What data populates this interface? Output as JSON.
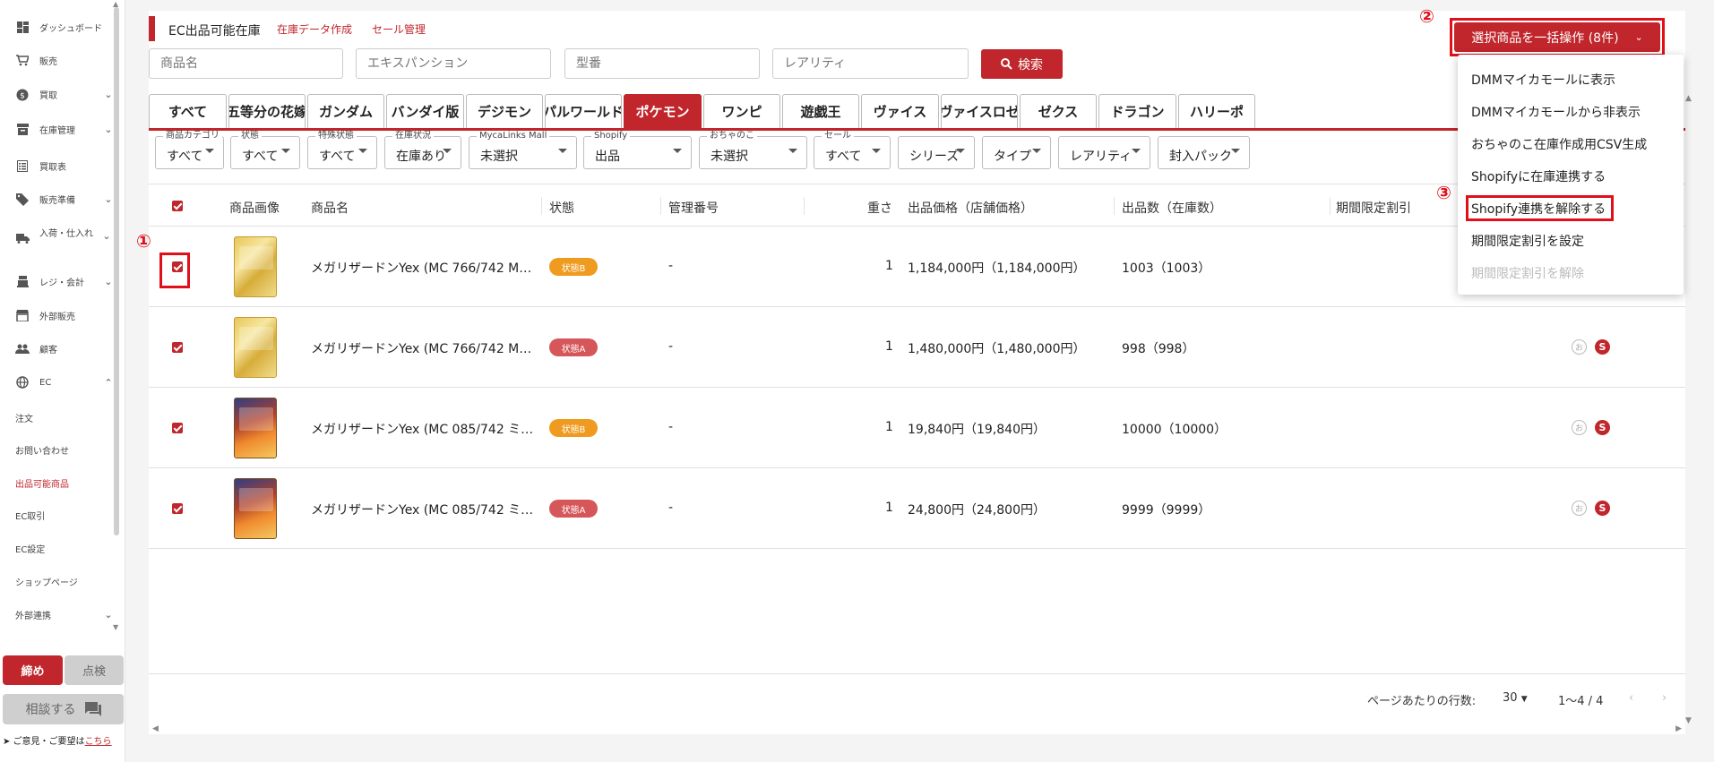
{
  "sidebar": {
    "items": [
      {
        "label": "ダッシュボード",
        "icon": "dashboard-icon",
        "chevron": ""
      },
      {
        "label": "販売",
        "icon": "cart-icon",
        "chevron": ""
      },
      {
        "label": "買取",
        "icon": "dollar-icon",
        "chevron": "⌄"
      },
      {
        "label": "在庫管理",
        "icon": "archive-icon",
        "chevron": "⌄"
      },
      {
        "label": "買取表",
        "icon": "list-icon",
        "chevron": ""
      },
      {
        "label": "販売準備",
        "icon": "tag-icon",
        "chevron": "⌄"
      },
      {
        "label": "入荷・仕入れ",
        "icon": "truck-icon",
        "chevron": "⌄"
      },
      {
        "label": "レジ・会計",
        "icon": "register-icon",
        "chevron": "⌄"
      },
      {
        "label": "外部販売",
        "icon": "store-icon",
        "chevron": ""
      },
      {
        "label": "顧客",
        "icon": "people-icon",
        "chevron": ""
      },
      {
        "label": "EC",
        "icon": "globe-icon",
        "chevron": "⌃"
      }
    ],
    "ec_sub": [
      "注文",
      "お問い合わせ",
      "出品可能商品",
      "EC取引",
      "EC設定",
      "ショップページ"
    ],
    "external": {
      "label": "外部連携",
      "chevron": "⌄"
    },
    "close_label": "締め",
    "inspect_label": "点検",
    "consult_label": "相談する",
    "feedback_prefix": "➤ ご意見・ご要望は",
    "feedback_link": "こちら"
  },
  "header": {
    "title": "EC出品可能在庫",
    "link1": "在庫データ作成",
    "link2": "セール管理"
  },
  "search": {
    "name_placeholder": "商品名",
    "expansion_placeholder": "エキスパンション",
    "model_placeholder": "型番",
    "rarity_placeholder": "レアリティ",
    "button_label": "検索"
  },
  "bulk": {
    "button_label": "選択商品を一括操作 (8件)",
    "menu": [
      "DMMマイカモールに表示",
      "DMMマイカモールから非表示",
      "おちゃのこ在庫作成用CSV生成",
      "Shopifyに在庫連携する",
      "Shopify連携を解除する",
      "期間限定割引を設定",
      "期間限定割引を解除"
    ]
  },
  "annotations": {
    "n1": "①",
    "n2": "②",
    "n3": "③"
  },
  "tabs": [
    "すべて",
    "五等分の花嫁",
    "ガンダム",
    "バンダイ版",
    "デジモン",
    "パルワールド",
    "ポケモン",
    "ワンピ",
    "遊戯王",
    "ヴァイス",
    "ヴァイスロゼ",
    "ゼクス",
    "ドラゴン",
    "ハリーポ"
  ],
  "active_tab": "ポケモン",
  "filters": [
    {
      "label": "商品カテゴリ",
      "value": "すべて"
    },
    {
      "label": "状態",
      "value": "すべて"
    },
    {
      "label": "特殊状態",
      "value": "すべて"
    },
    {
      "label": "在庫状況",
      "value": "在庫あり"
    },
    {
      "label": "MycaLinks Mall",
      "value": "未選択"
    },
    {
      "label": "Shopify",
      "value": "出品"
    },
    {
      "label": "おちゃのこ",
      "value": "未選択"
    },
    {
      "label": "セール",
      "value": "すべて"
    },
    {
      "label": "",
      "value": "シリーズ"
    },
    {
      "label": "",
      "value": "タイプ"
    },
    {
      "label": "",
      "value": "レアリティ"
    },
    {
      "label": "",
      "value": "封入パック"
    }
  ],
  "table": {
    "headers": {
      "image": "商品画像",
      "name": "商品名",
      "condition": "状態",
      "manage_no": "管理番号",
      "weight": "重さ",
      "price": "出品価格（店舗価格）",
      "qty": "出品数（在庫数）",
      "discount": "期間限定割引"
    },
    "rows": [
      {
        "name": "メガリザードンYex (MC 766/742 M…",
        "condition": "状態B",
        "manage_no": "-",
        "weight": "1",
        "price": "1,184,000円（1,184,000円）",
        "qty": "1003（1003）"
      },
      {
        "name": "メガリザードンYex (MC 766/742 M…",
        "condition": "状態A",
        "manage_no": "-",
        "weight": "1",
        "price": "1,480,000円（1,480,000円）",
        "qty": "998（998）"
      },
      {
        "name": "メガリザードンYex (MC 085/742 ミ…",
        "condition": "状態B",
        "manage_no": "-",
        "weight": "1",
        "price": "19,840円（19,840円）",
        "qty": "10000（10000）"
      },
      {
        "name": "メガリザードンYex (MC 085/742 ミ…",
        "condition": "状態A",
        "manage_no": "-",
        "weight": "1",
        "price": "24,800円（24,800円）",
        "qty": "9999（9999）"
      }
    ]
  },
  "pagination": {
    "rows_label": "ページあたりの行数:",
    "rows_value": "30",
    "range": "1〜4 / 4"
  },
  "colors": {
    "accent": "#c0262b",
    "highlight": "#e0101a",
    "badge_b": "#ef9b1f",
    "badge_a": "#d5575a"
  }
}
